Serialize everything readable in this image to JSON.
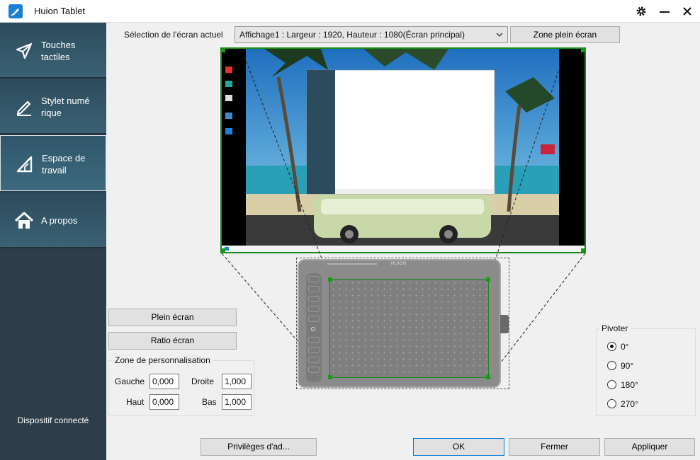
{
  "window": {
    "title": "Huion Tablet"
  },
  "sidebar": {
    "items": [
      {
        "label": "Touches tactiles",
        "icon": "send-arrow-icon"
      },
      {
        "label": "Stylet numé rique",
        "icon": "pen-icon"
      },
      {
        "label": "Espace de travail",
        "icon": "workspace-triangle-icon"
      },
      {
        "label": "A propos",
        "icon": "home-icon"
      }
    ],
    "active_index": 2,
    "device_status": "Dispositif connecté"
  },
  "screen": {
    "label": "Sélection de l'écran actuel",
    "selected": "Affichage1 : Largeur : 1920, Hauteur : 1080(Écran principal)",
    "full_zone_label": "Zone plein écran"
  },
  "mapping": {
    "full_screen_label": "Plein écran",
    "screen_ratio_label": "Ratio écran"
  },
  "custom_zone": {
    "title": "Zone de personnalisation",
    "left_label": "Gauche",
    "left_value": "0,000",
    "right_label": "Droite",
    "right_value": "1,000",
    "top_label": "Haut",
    "top_value": "0,000",
    "bottom_label": "Bas",
    "bottom_value": "1,000"
  },
  "tablet": {
    "brand": "HUION"
  },
  "rotate": {
    "title": "Pivoter",
    "options": [
      "0°",
      "90°",
      "180°",
      "270°"
    ],
    "selected_index": 0
  },
  "footer": {
    "privileges_label": "Privilèges d'ad...",
    "ok_label": "OK",
    "close_label": "Fermer",
    "apply_label": "Appliquer"
  },
  "colors": {
    "sidebar": "#2d3d49",
    "nav": "#3a6274",
    "active_area": "#1a8a1a",
    "accent": "#0078d7"
  }
}
